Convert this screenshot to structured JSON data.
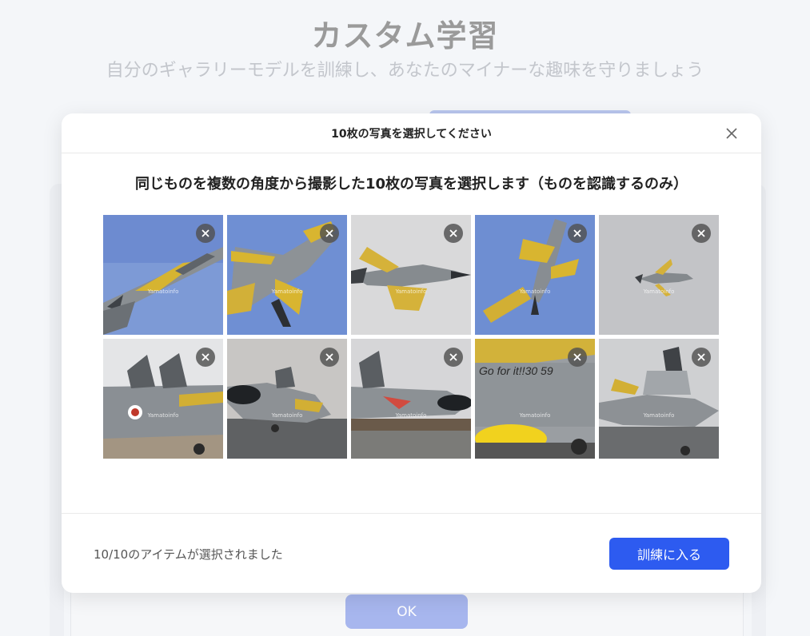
{
  "background": {
    "title": "カスタム学習",
    "subtitle": "自分のギャラリーモデルを訓練し、あなたのマイナーな趣味を守りましょう",
    "ok_label": "OK"
  },
  "modal": {
    "title": "10枚の写真を選択してください",
    "close_icon": "close-icon",
    "instruction": "同じものを複数の角度から撮影した10枚の写真を選択します（ものを認識するのみ）",
    "photos": [
      {
        "watermark": "Yamatoinfo",
        "remove_icon": "close-icon"
      },
      {
        "watermark": "Yamatoinfo",
        "remove_icon": "close-icon"
      },
      {
        "watermark": "Yamatoinfo",
        "remove_icon": "close-icon"
      },
      {
        "watermark": "Yamatoinfo",
        "remove_icon": "close-icon"
      },
      {
        "watermark": "Yamatoinfo",
        "remove_icon": "close-icon"
      },
      {
        "watermark": "Yamatoinfo",
        "remove_icon": "close-icon"
      },
      {
        "watermark": "Yamatoinfo",
        "remove_icon": "close-icon"
      },
      {
        "watermark": "Yamatoinfo",
        "remove_icon": "close-icon"
      },
      {
        "watermark": "Yamatoinfo",
        "remove_icon": "close-icon"
      },
      {
        "watermark": "Yamatoinfo",
        "remove_icon": "close-icon"
      }
    ],
    "selection_status": "10/10のアイテムが選択されました",
    "train_button_label": "訓練に入る"
  },
  "colors": {
    "primary": "#2d5bf0",
    "background_ok": "#a7b6ee"
  }
}
